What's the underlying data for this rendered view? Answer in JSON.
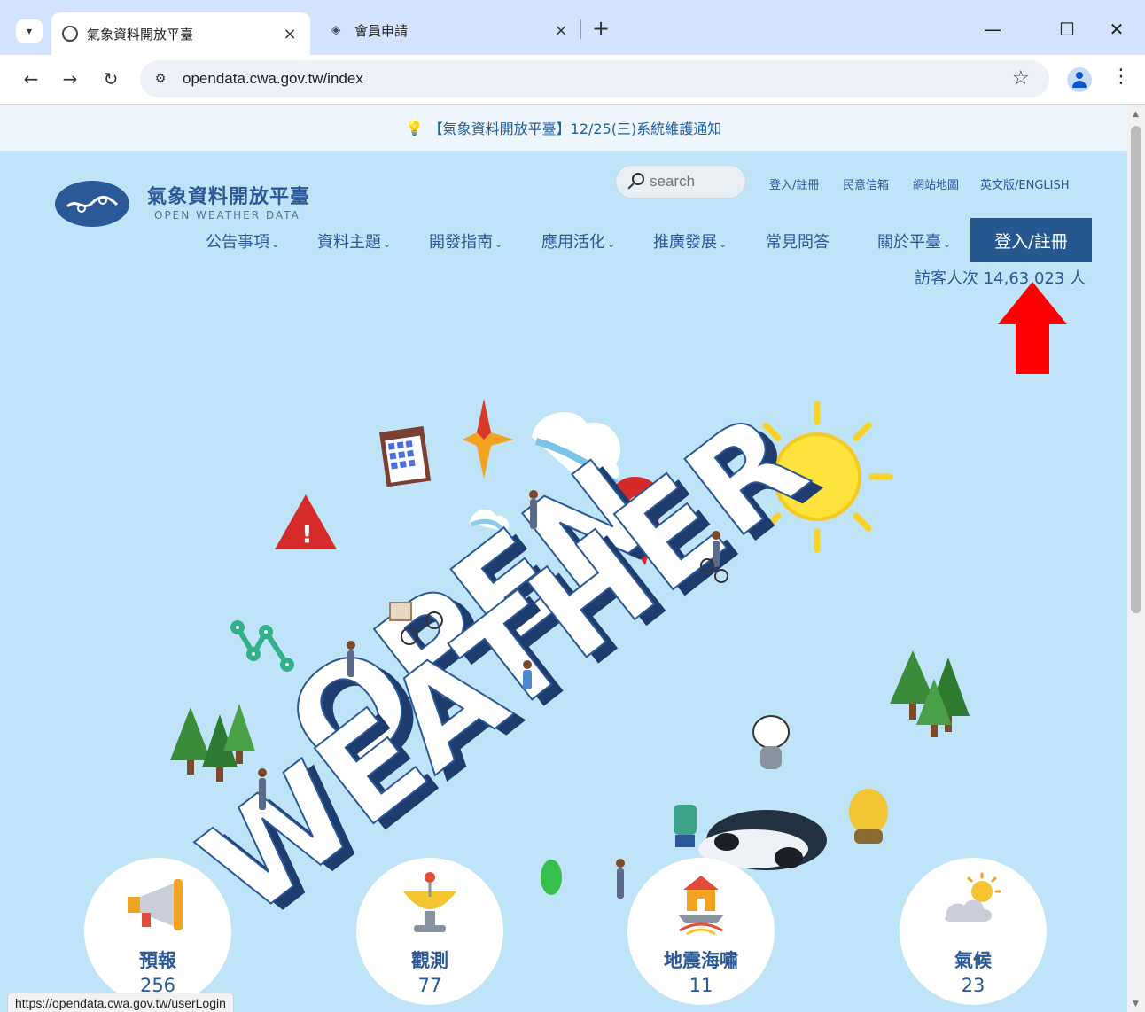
{
  "browser": {
    "tabs": [
      {
        "title": "氣象資料開放平臺",
        "active": true
      },
      {
        "title": "會員申請",
        "active": false
      }
    ],
    "new_tab_symbol": "+",
    "close_symbol": "×",
    "url": "opendata.cwa.gov.tw/index",
    "window_controls": {
      "minimize": "—",
      "maximize": "☐",
      "close": "✕"
    },
    "status_url": "https://opendata.cwa.gov.tw/userLogin"
  },
  "page": {
    "notice": "【氣象資料開放平臺】12/25(三)系統維護通知",
    "site_title": "氣象資料開放平臺",
    "site_subtitle": "OPEN WEATHER DATA",
    "search_placeholder": "search",
    "top_links": [
      "登入/註冊",
      "民意信箱",
      "網站地圖",
      "英文版/ENGLISH"
    ],
    "nav": [
      {
        "label": "公告事項",
        "has_dropdown": true
      },
      {
        "label": "資料主題",
        "has_dropdown": true
      },
      {
        "label": "開發指南",
        "has_dropdown": true
      },
      {
        "label": "應用活化",
        "has_dropdown": true
      },
      {
        "label": "推廣發展",
        "has_dropdown": true
      },
      {
        "label": "常見問答",
        "has_dropdown": false
      },
      {
        "label": "關於平臺",
        "has_dropdown": true
      }
    ],
    "nav_chevron": "⌄",
    "login_button": "登入/註冊",
    "visitor_count": "訪客人次 14,63  023 人",
    "hero_words": [
      "OPEN",
      "WEATHER"
    ],
    "categories": [
      {
        "label": "預報",
        "count": "256",
        "icon": "megaphone-icon"
      },
      {
        "label": "觀測",
        "count": "77",
        "icon": "satellite-dish-icon"
      },
      {
        "label": "地震海嘯",
        "count": "11",
        "icon": "earthquake-house-icon"
      },
      {
        "label": "氣候",
        "count": "23",
        "icon": "sun-cloud-icon"
      }
    ]
  },
  "colors": {
    "brand_blue": "#2b5897",
    "login_button_bg": "#27578f",
    "hero_bg": "#bfe4f8",
    "annotation_arrow": "#ff0000"
  }
}
